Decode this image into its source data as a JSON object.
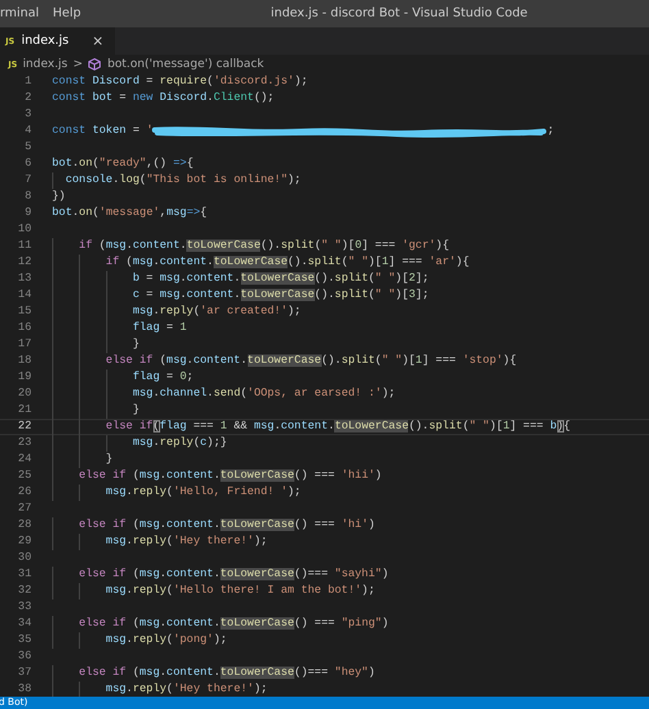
{
  "title_bar": {
    "menu": [
      "rminal",
      "Help"
    ],
    "title": "index.js - discord Bot - Visual Studio Code"
  },
  "tabs": [
    {
      "icon_text": "JS",
      "label": "index.js",
      "close": "×",
      "selected": true
    }
  ],
  "breadcrumb": {
    "file_icon_text": "JS",
    "file": "index.js",
    "separator": ">",
    "symbol": "bot.on('message') callback"
  },
  "editor": {
    "lines": [
      {
        "number": "1",
        "current": false,
        "tokens": [
          {
            "text": "const ",
            "kind": "kw"
          },
          {
            "text": "Discord",
            "kind": "var"
          },
          {
            "text": " = ",
            "kind": "p"
          },
          {
            "text": "require",
            "kind": "fn"
          },
          {
            "text": "(",
            "kind": "p"
          },
          {
            "text": "'discord.js'",
            "kind": "str"
          },
          {
            "text": ");",
            "kind": "p"
          }
        ]
      },
      {
        "number": "2",
        "current": false,
        "tokens": [
          {
            "text": "const ",
            "kind": "kw"
          },
          {
            "text": "bot",
            "kind": "var"
          },
          {
            "text": " = ",
            "kind": "p"
          },
          {
            "text": "new ",
            "kind": "kw"
          },
          {
            "text": "Discord",
            "kind": "var"
          },
          {
            "text": ".",
            "kind": "p"
          },
          {
            "text": "Client",
            "kind": "cls"
          },
          {
            "text": "();",
            "kind": "p"
          }
        ]
      },
      {
        "number": "3",
        "current": false
      },
      {
        "number": "4",
        "current": false,
        "tokens": [
          {
            "text": "const ",
            "kind": "kw"
          },
          {
            "text": "token",
            "kind": "var"
          },
          {
            "text": " = ",
            "kind": "p"
          },
          {
            "text": "'",
            "kind": "str"
          },
          {
            "kind": "redaction"
          },
          {
            "text": ";",
            "kind": "p"
          }
        ]
      },
      {
        "number": "5",
        "current": false
      },
      {
        "number": "6",
        "current": false,
        "tokens": [
          {
            "text": "bot",
            "kind": "var"
          },
          {
            "text": ".",
            "kind": "p"
          },
          {
            "text": "on",
            "kind": "fn"
          },
          {
            "text": "(",
            "kind": "p"
          },
          {
            "text": "\"ready\"",
            "kind": "str"
          },
          {
            "text": ",() ",
            "kind": "p"
          },
          {
            "text": "=>",
            "kind": "kw"
          },
          {
            "text": "{",
            "kind": "p"
          }
        ]
      },
      {
        "number": "7",
        "current": false,
        "tokens": [
          {
            "text": "  console",
            "kind": "var"
          },
          {
            "text": ".",
            "kind": "p"
          },
          {
            "text": "log",
            "kind": "fn"
          },
          {
            "text": "(",
            "kind": "p"
          },
          {
            "text": "\"This bot is online!\"",
            "kind": "str"
          },
          {
            "text": ");",
            "kind": "p"
          }
        ]
      },
      {
        "number": "8",
        "current": false,
        "tokens": [
          {
            "text": "})",
            "kind": "p"
          }
        ]
      },
      {
        "number": "9",
        "current": false,
        "tokens": [
          {
            "text": "bot",
            "kind": "var"
          },
          {
            "text": ".",
            "kind": "p"
          },
          {
            "text": "on",
            "kind": "fn"
          },
          {
            "text": "(",
            "kind": "p"
          },
          {
            "text": "'message'",
            "kind": "str"
          },
          {
            "text": ",",
            "kind": "p"
          },
          {
            "text": "msg",
            "kind": "var"
          },
          {
            "text": "=>",
            "kind": "kw"
          },
          {
            "text": "{",
            "kind": "p"
          }
        ]
      },
      {
        "number": "10",
        "current": false
      },
      {
        "number": "11",
        "current": false,
        "tokens": [
          {
            "text": "    if",
            "kind": "ctl"
          },
          {
            "text": " (",
            "kind": "p"
          },
          {
            "text": "msg",
            "kind": "var"
          },
          {
            "text": ".",
            "kind": "p"
          },
          {
            "text": "content",
            "kind": "var"
          },
          {
            "text": ".",
            "kind": "p"
          },
          {
            "text": "toLowerCase",
            "kind": "hl"
          },
          {
            "text": "().",
            "kind": "p"
          },
          {
            "text": "split",
            "kind": "fn"
          },
          {
            "text": "(",
            "kind": "p"
          },
          {
            "text": "\" \"",
            "kind": "str"
          },
          {
            "text": ")[",
            "kind": "p"
          },
          {
            "text": "0",
            "kind": "num"
          },
          {
            "text": "] === ",
            "kind": "p"
          },
          {
            "text": "'gcr'",
            "kind": "str"
          },
          {
            "text": "){",
            "kind": "p"
          }
        ]
      },
      {
        "number": "12",
        "current": false,
        "tokens": [
          {
            "text": "        if",
            "kind": "ctl"
          },
          {
            "text": " (",
            "kind": "p"
          },
          {
            "text": "msg",
            "kind": "var"
          },
          {
            "text": ".",
            "kind": "p"
          },
          {
            "text": "content",
            "kind": "var"
          },
          {
            "text": ".",
            "kind": "p"
          },
          {
            "text": "toLowerCase",
            "kind": "hl"
          },
          {
            "text": "().",
            "kind": "p"
          },
          {
            "text": "split",
            "kind": "fn"
          },
          {
            "text": "(",
            "kind": "p"
          },
          {
            "text": "\" \"",
            "kind": "str"
          },
          {
            "text": ")[",
            "kind": "p"
          },
          {
            "text": "1",
            "kind": "num"
          },
          {
            "text": "] === ",
            "kind": "p"
          },
          {
            "text": "'ar'",
            "kind": "str"
          },
          {
            "text": "){",
            "kind": "p"
          }
        ]
      },
      {
        "number": "13",
        "current": false,
        "tokens": [
          {
            "text": "            b",
            "kind": "var"
          },
          {
            "text": " = ",
            "kind": "p"
          },
          {
            "text": "msg",
            "kind": "var"
          },
          {
            "text": ".",
            "kind": "p"
          },
          {
            "text": "content",
            "kind": "var"
          },
          {
            "text": ".",
            "kind": "p"
          },
          {
            "text": "toLowerCase",
            "kind": "hl"
          },
          {
            "text": "().",
            "kind": "p"
          },
          {
            "text": "split",
            "kind": "fn"
          },
          {
            "text": "(",
            "kind": "p"
          },
          {
            "text": "\" \"",
            "kind": "str"
          },
          {
            "text": ")[",
            "kind": "p"
          },
          {
            "text": "2",
            "kind": "num"
          },
          {
            "text": "];",
            "kind": "p"
          }
        ]
      },
      {
        "number": "14",
        "current": false,
        "tokens": [
          {
            "text": "            c",
            "kind": "var"
          },
          {
            "text": " = ",
            "kind": "p"
          },
          {
            "text": "msg",
            "kind": "var"
          },
          {
            "text": ".",
            "kind": "p"
          },
          {
            "text": "content",
            "kind": "var"
          },
          {
            "text": ".",
            "kind": "p"
          },
          {
            "text": "toLowerCase",
            "kind": "hl"
          },
          {
            "text": "().",
            "kind": "p"
          },
          {
            "text": "split",
            "kind": "fn"
          },
          {
            "text": "(",
            "kind": "p"
          },
          {
            "text": "\" \"",
            "kind": "str"
          },
          {
            "text": ")[",
            "kind": "p"
          },
          {
            "text": "3",
            "kind": "num"
          },
          {
            "text": "];",
            "kind": "p"
          }
        ]
      },
      {
        "number": "15",
        "current": false,
        "tokens": [
          {
            "text": "            msg",
            "kind": "var"
          },
          {
            "text": ".",
            "kind": "p"
          },
          {
            "text": "reply",
            "kind": "fn"
          },
          {
            "text": "(",
            "kind": "p"
          },
          {
            "text": "'ar created!'",
            "kind": "str"
          },
          {
            "text": ");",
            "kind": "p"
          }
        ]
      },
      {
        "number": "16",
        "current": false,
        "tokens": [
          {
            "text": "            flag",
            "kind": "var"
          },
          {
            "text": " = ",
            "kind": "p"
          },
          {
            "text": "1",
            "kind": "num"
          }
        ]
      },
      {
        "number": "17",
        "current": false,
        "tokens": [
          {
            "text": "            }",
            "kind": "p"
          }
        ]
      },
      {
        "number": "18",
        "current": false,
        "tokens": [
          {
            "text": "        else if",
            "kind": "ctl"
          },
          {
            "text": " (",
            "kind": "p"
          },
          {
            "text": "msg",
            "kind": "var"
          },
          {
            "text": ".",
            "kind": "p"
          },
          {
            "text": "content",
            "kind": "var"
          },
          {
            "text": ".",
            "kind": "p"
          },
          {
            "text": "toLowerCase",
            "kind": "hl"
          },
          {
            "text": "().",
            "kind": "p"
          },
          {
            "text": "split",
            "kind": "fn"
          },
          {
            "text": "(",
            "kind": "p"
          },
          {
            "text": "\" \"",
            "kind": "str"
          },
          {
            "text": ")[",
            "kind": "p"
          },
          {
            "text": "1",
            "kind": "num"
          },
          {
            "text": "] === ",
            "kind": "p"
          },
          {
            "text": "'stop'",
            "kind": "str"
          },
          {
            "text": "){",
            "kind": "p"
          }
        ]
      },
      {
        "number": "19",
        "current": false,
        "tokens": [
          {
            "text": "            flag",
            "kind": "var"
          },
          {
            "text": " = ",
            "kind": "p"
          },
          {
            "text": "0",
            "kind": "num"
          },
          {
            "text": ";",
            "kind": "p"
          }
        ]
      },
      {
        "number": "20",
        "current": false,
        "tokens": [
          {
            "text": "            msg",
            "kind": "var"
          },
          {
            "text": ".",
            "kind": "p"
          },
          {
            "text": "channel",
            "kind": "var"
          },
          {
            "text": ".",
            "kind": "p"
          },
          {
            "text": "send",
            "kind": "fn"
          },
          {
            "text": "(",
            "kind": "p"
          },
          {
            "text": "'OOps, ar earsed! :'",
            "kind": "str"
          },
          {
            "text": ");",
            "kind": "p"
          }
        ]
      },
      {
        "number": "21",
        "current": false,
        "tokens": [
          {
            "text": "            }",
            "kind": "p"
          }
        ]
      },
      {
        "number": "22",
        "current": true,
        "tokens": [
          {
            "text": "        else if",
            "kind": "ctl"
          },
          {
            "text": "(",
            "kind": "br"
          },
          {
            "text": "flag",
            "kind": "var"
          },
          {
            "text": " === ",
            "kind": "p"
          },
          {
            "text": "1",
            "kind": "num"
          },
          {
            "text": " && ",
            "kind": "p"
          },
          {
            "text": "msg",
            "kind": "var"
          },
          {
            "text": ".",
            "kind": "p"
          },
          {
            "text": "content",
            "kind": "var"
          },
          {
            "text": ".",
            "kind": "p"
          },
          {
            "text": "toLowerCase",
            "kind": "hl"
          },
          {
            "text": "().",
            "kind": "p"
          },
          {
            "text": "split",
            "kind": "fn"
          },
          {
            "text": "(",
            "kind": "p"
          },
          {
            "text": "\" \"",
            "kind": "str"
          },
          {
            "text": ")[",
            "kind": "p"
          },
          {
            "text": "1",
            "kind": "num"
          },
          {
            "text": "] === ",
            "kind": "p"
          },
          {
            "text": "b",
            "kind": "var"
          },
          {
            "text": ")",
            "kind": "br"
          },
          {
            "text": "{",
            "kind": "p"
          }
        ]
      },
      {
        "number": "23",
        "current": false,
        "tokens": [
          {
            "text": "            msg",
            "kind": "var"
          },
          {
            "text": ".",
            "kind": "p"
          },
          {
            "text": "reply",
            "kind": "fn"
          },
          {
            "text": "(",
            "kind": "p"
          },
          {
            "text": "c",
            "kind": "var"
          },
          {
            "text": ");}",
            "kind": "p"
          }
        ]
      },
      {
        "number": "24",
        "current": false,
        "tokens": [
          {
            "text": "        }",
            "kind": "p"
          }
        ]
      },
      {
        "number": "25",
        "current": false,
        "tokens": [
          {
            "text": "    else if",
            "kind": "ctl"
          },
          {
            "text": " (",
            "kind": "p"
          },
          {
            "text": "msg",
            "kind": "var"
          },
          {
            "text": ".",
            "kind": "p"
          },
          {
            "text": "content",
            "kind": "var"
          },
          {
            "text": ".",
            "kind": "p"
          },
          {
            "text": "toLowerCase",
            "kind": "hl"
          },
          {
            "text": "() === ",
            "kind": "p"
          },
          {
            "text": "'hii'",
            "kind": "str"
          },
          {
            "text": ")",
            "kind": "p"
          }
        ]
      },
      {
        "number": "26",
        "current": false,
        "tokens": [
          {
            "text": "        msg",
            "kind": "var"
          },
          {
            "text": ".",
            "kind": "p"
          },
          {
            "text": "reply",
            "kind": "fn"
          },
          {
            "text": "(",
            "kind": "p"
          },
          {
            "text": "'Hello, Friend! '",
            "kind": "str"
          },
          {
            "text": ");",
            "kind": "p"
          }
        ]
      },
      {
        "number": "27",
        "current": false
      },
      {
        "number": "28",
        "current": false,
        "tokens": [
          {
            "text": "    else if",
            "kind": "ctl"
          },
          {
            "text": " (",
            "kind": "p"
          },
          {
            "text": "msg",
            "kind": "var"
          },
          {
            "text": ".",
            "kind": "p"
          },
          {
            "text": "content",
            "kind": "var"
          },
          {
            "text": ".",
            "kind": "p"
          },
          {
            "text": "toLowerCase",
            "kind": "hl"
          },
          {
            "text": "() === ",
            "kind": "p"
          },
          {
            "text": "'hi'",
            "kind": "str"
          },
          {
            "text": ")",
            "kind": "p"
          }
        ]
      },
      {
        "number": "29",
        "current": false,
        "tokens": [
          {
            "text": "        msg",
            "kind": "var"
          },
          {
            "text": ".",
            "kind": "p"
          },
          {
            "text": "reply",
            "kind": "fn"
          },
          {
            "text": "(",
            "kind": "p"
          },
          {
            "text": "'Hey there!'",
            "kind": "str"
          },
          {
            "text": ");",
            "kind": "p"
          }
        ]
      },
      {
        "number": "30",
        "current": false
      },
      {
        "number": "31",
        "current": false,
        "tokens": [
          {
            "text": "    else if",
            "kind": "ctl"
          },
          {
            "text": " (",
            "kind": "p"
          },
          {
            "text": "msg",
            "kind": "var"
          },
          {
            "text": ".",
            "kind": "p"
          },
          {
            "text": "content",
            "kind": "var"
          },
          {
            "text": ".",
            "kind": "p"
          },
          {
            "text": "toLowerCase",
            "kind": "hl"
          },
          {
            "text": "()=== ",
            "kind": "p"
          },
          {
            "text": "\"sayhi\"",
            "kind": "str"
          },
          {
            "text": ")",
            "kind": "p"
          }
        ]
      },
      {
        "number": "32",
        "current": false,
        "tokens": [
          {
            "text": "        msg",
            "kind": "var"
          },
          {
            "text": ".",
            "kind": "p"
          },
          {
            "text": "reply",
            "kind": "fn"
          },
          {
            "text": "(",
            "kind": "p"
          },
          {
            "text": "'Hello there! I am the bot!'",
            "kind": "str"
          },
          {
            "text": ");",
            "kind": "p"
          }
        ]
      },
      {
        "number": "33",
        "current": false
      },
      {
        "number": "34",
        "current": false,
        "tokens": [
          {
            "text": "    else if",
            "kind": "ctl"
          },
          {
            "text": " (",
            "kind": "p"
          },
          {
            "text": "msg",
            "kind": "var"
          },
          {
            "text": ".",
            "kind": "p"
          },
          {
            "text": "content",
            "kind": "var"
          },
          {
            "text": ".",
            "kind": "p"
          },
          {
            "text": "toLowerCase",
            "kind": "hl"
          },
          {
            "text": "() === ",
            "kind": "p"
          },
          {
            "text": "\"ping\"",
            "kind": "str"
          },
          {
            "text": ")",
            "kind": "p"
          }
        ]
      },
      {
        "number": "35",
        "current": false,
        "tokens": [
          {
            "text": "        msg",
            "kind": "var"
          },
          {
            "text": ".",
            "kind": "p"
          },
          {
            "text": "reply",
            "kind": "fn"
          },
          {
            "text": "(",
            "kind": "p"
          },
          {
            "text": "'pong'",
            "kind": "str"
          },
          {
            "text": ");",
            "kind": "p"
          }
        ]
      },
      {
        "number": "36",
        "current": false
      },
      {
        "number": "37",
        "current": false,
        "tokens": [
          {
            "text": "    else if",
            "kind": "ctl"
          },
          {
            "text": " (",
            "kind": "p"
          },
          {
            "text": "msg",
            "kind": "var"
          },
          {
            "text": ".",
            "kind": "p"
          },
          {
            "text": "content",
            "kind": "var"
          },
          {
            "text": ".",
            "kind": "p"
          },
          {
            "text": "toLowerCase",
            "kind": "hl"
          },
          {
            "text": "()=== ",
            "kind": "p"
          },
          {
            "text": "\"hey\"",
            "kind": "str"
          },
          {
            "text": ")",
            "kind": "p"
          }
        ]
      },
      {
        "number": "38",
        "current": false,
        "tokens": [
          {
            "text": "        msg",
            "kind": "var"
          },
          {
            "text": ".",
            "kind": "p"
          },
          {
            "text": "reply",
            "kind": "fn"
          },
          {
            "text": "(",
            "kind": "p"
          },
          {
            "text": "'Hey there!'",
            "kind": "str"
          },
          {
            "text": ");",
            "kind": "p"
          }
        ]
      }
    ]
  },
  "status_bar": {
    "text": "d Bot)"
  }
}
